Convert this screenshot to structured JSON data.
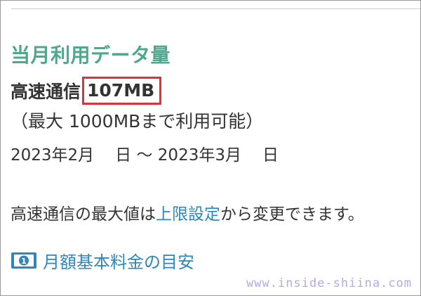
{
  "section": {
    "title": "当月利用データ量"
  },
  "usage": {
    "label": "高速通信",
    "value": "107MB",
    "limit_text": "（最大 1000MBまで利用可能）"
  },
  "period": {
    "start": "2023年2月",
    "start_day_suffix": "日",
    "separator": "～",
    "end": "2023年3月",
    "end_day_suffix": "日"
  },
  "info": {
    "prefix": "高速通信の最大値は",
    "link_label": "上限設定",
    "suffix": "から変更できます。"
  },
  "fee": {
    "icon": "money-bill-icon",
    "link_label": "月額基本料金の目安"
  },
  "watermark": "www.inside-shiina.com",
  "colors": {
    "title": "#4fa78e",
    "link": "#2f86b8",
    "highlight_border": "#d9343b",
    "icon": "#2f86b8"
  }
}
